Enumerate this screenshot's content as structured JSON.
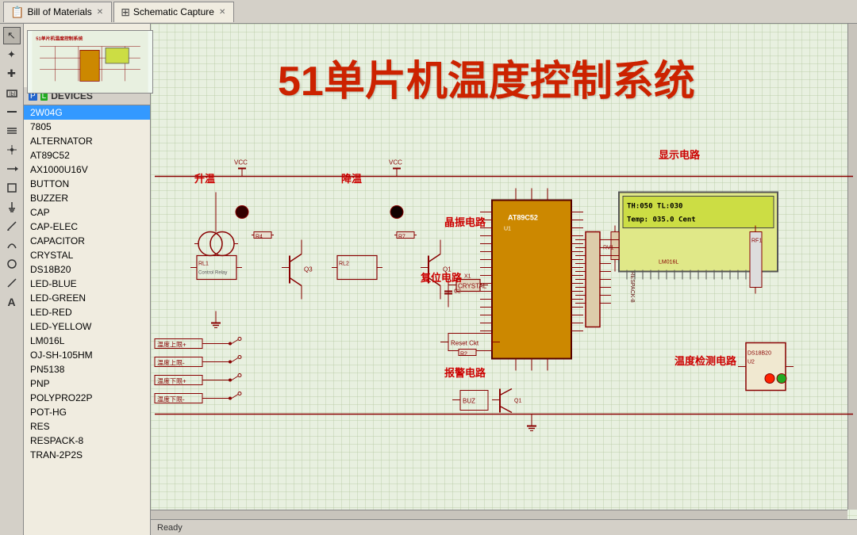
{
  "tabs": [
    {
      "id": "bom",
      "label": "Bill of Materials",
      "icon": "📋",
      "active": false
    },
    {
      "id": "schematic",
      "label": "Schematic Capture",
      "icon": "⚡",
      "active": true
    }
  ],
  "toolbar": {
    "tools": [
      {
        "name": "select",
        "icon": "↖",
        "active": true
      },
      {
        "name": "move",
        "icon": "✚"
      },
      {
        "name": "label",
        "icon": "A"
      },
      {
        "name": "wire",
        "icon": "━"
      },
      {
        "name": "bus",
        "icon": "≡"
      },
      {
        "name": "junction",
        "icon": "+"
      },
      {
        "name": "net",
        "icon": "→"
      },
      {
        "name": "component",
        "icon": "□"
      },
      {
        "name": "power",
        "icon": "⚡"
      },
      {
        "name": "pin",
        "icon": "◈"
      },
      {
        "name": "arc",
        "icon": "◠"
      },
      {
        "name": "circle",
        "icon": "○"
      },
      {
        "name": "line",
        "icon": "/"
      },
      {
        "name": "text",
        "icon": "T"
      }
    ]
  },
  "side_panel": {
    "icons": {
      "p": "P",
      "l": "L"
    },
    "title": "DEVICES",
    "devices": [
      {
        "id": "2W04G",
        "label": "2W04G",
        "selected": true
      },
      {
        "id": "7805",
        "label": "7805"
      },
      {
        "id": "ALTERNATOR",
        "label": "ALTERNATOR"
      },
      {
        "id": "AT89C52",
        "label": "AT89C52"
      },
      {
        "id": "AX1000U16V",
        "label": "AX1000U16V"
      },
      {
        "id": "BUTTON",
        "label": "BUTTON"
      },
      {
        "id": "BUZZER",
        "label": "BUZZER"
      },
      {
        "id": "CAP",
        "label": "CAP"
      },
      {
        "id": "CAP-ELEC",
        "label": "CAP-ELEC"
      },
      {
        "id": "CAPACITOR",
        "label": "CAPACITOR"
      },
      {
        "id": "CRYSTAL",
        "label": "CRYSTAL"
      },
      {
        "id": "DS18B20",
        "label": "DS18B20"
      },
      {
        "id": "LED-BLUE",
        "label": "LED-BLUE"
      },
      {
        "id": "LED-GREEN",
        "label": "LED-GREEN"
      },
      {
        "id": "LED-RED",
        "label": "LED-RED"
      },
      {
        "id": "LED-YELLOW",
        "label": "LED-YELLOW"
      },
      {
        "id": "LM016L",
        "label": "LM016L"
      },
      {
        "id": "OJ-SH-105HM",
        "label": "OJ-SH-105HM"
      },
      {
        "id": "PN5138",
        "label": "PN5138"
      },
      {
        "id": "PNP",
        "label": "PNP"
      },
      {
        "id": "POLYPRO22P",
        "label": "POLYPRO22P"
      },
      {
        "id": "POT-HG",
        "label": "POT-HG"
      },
      {
        "id": "RES",
        "label": "RES"
      },
      {
        "id": "RESPACK-8",
        "label": "RESPACK-8"
      },
      {
        "id": "TRAN-2P2S",
        "label": "TRAN-2P2S"
      }
    ]
  },
  "schematic": {
    "title": "51单片机温度控制系统",
    "labels": {
      "up_temp": "升温",
      "down_temp": "降温",
      "crystal_circuit": "晶振电路",
      "reset_circuit": "复位电路",
      "display_circuit": "显示电路",
      "temp_detect": "温度检测电路",
      "alarm_circuit": "报警电路",
      "temp_upper_limit1": "温度上限+",
      "temp_upper_limit2": "温度上限-",
      "temp_lower_limit1": "温度下限+",
      "temp_lower_limit2": "温度下限-"
    },
    "display": {
      "line1": "TH:050 TL:030",
      "line2": "Temp: 035.0 Cent"
    }
  }
}
